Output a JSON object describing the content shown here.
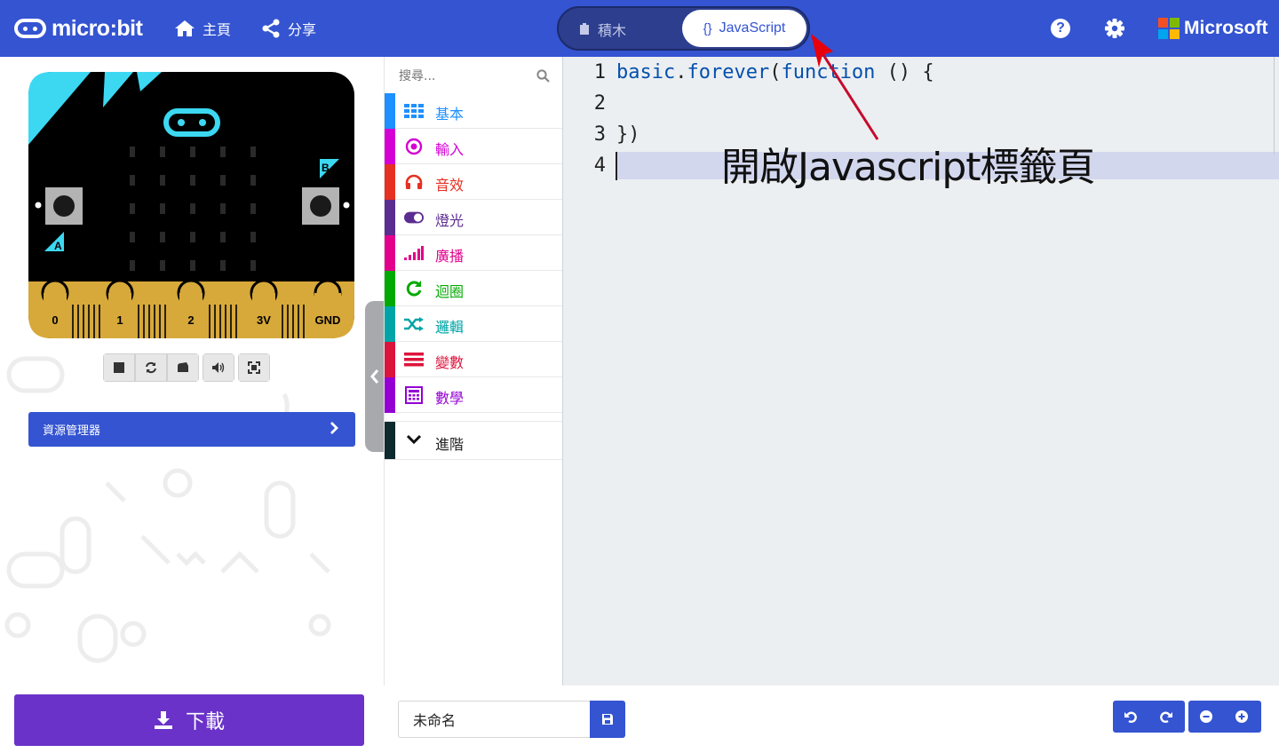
{
  "header": {
    "logo_text": "micro:bit",
    "home_label": "主頁",
    "share_label": "分享",
    "blocks_tab": "積木",
    "js_tab": "JavaScript",
    "js_tab_glyph": "{}",
    "help_glyph": "?",
    "brand": "Microsoft",
    "brand_colors": [
      "#f25022",
      "#7fba00",
      "#00a4ef",
      "#ffb900"
    ]
  },
  "simulator": {
    "pins": [
      "0",
      "1",
      "2",
      "3V",
      "GND"
    ],
    "button_a": "A",
    "button_b": "B",
    "controls": [
      "stop-icon",
      "restart-icon",
      "slowmo-icon",
      "mute-icon",
      "fullscreen-icon"
    ],
    "explorer_label": "資源管理器"
  },
  "toolbox": {
    "search_placeholder": "搜尋...",
    "categories": [
      {
        "label": "基本",
        "color": "#1e90ff",
        "icon": "grid-icon"
      },
      {
        "label": "輸入",
        "color": "#d400d4",
        "icon": "target-icon"
      },
      {
        "label": "音效",
        "color": "#e63022",
        "icon": "headphones-icon"
      },
      {
        "label": "燈光",
        "color": "#5c2d91",
        "icon": "toggle-icon"
      },
      {
        "label": "廣播",
        "color": "#e3008c",
        "icon": "signal-icon"
      },
      {
        "label": "迴圈",
        "color": "#00aa00",
        "icon": "refresh-icon"
      },
      {
        "label": "邏輯",
        "color": "#00a4a6",
        "icon": "shuffle-icon"
      },
      {
        "label": "變數",
        "color": "#dc143c",
        "icon": "list-icon"
      },
      {
        "label": "數學",
        "color": "#9400d3",
        "icon": "calculator-icon"
      }
    ],
    "advanced_label": "進階"
  },
  "editor": {
    "line_numbers": [
      "1",
      "2",
      "3",
      "4"
    ],
    "code": {
      "basic": "basic",
      "dot": ".",
      "forever": "forever",
      "paren_open": "(",
      "function_kw": "function",
      "rest": " () {",
      "close": "})"
    },
    "annotation": "開啟Javascript標籤頁"
  },
  "footer": {
    "download_label": "下載",
    "project_name": "未命名"
  }
}
